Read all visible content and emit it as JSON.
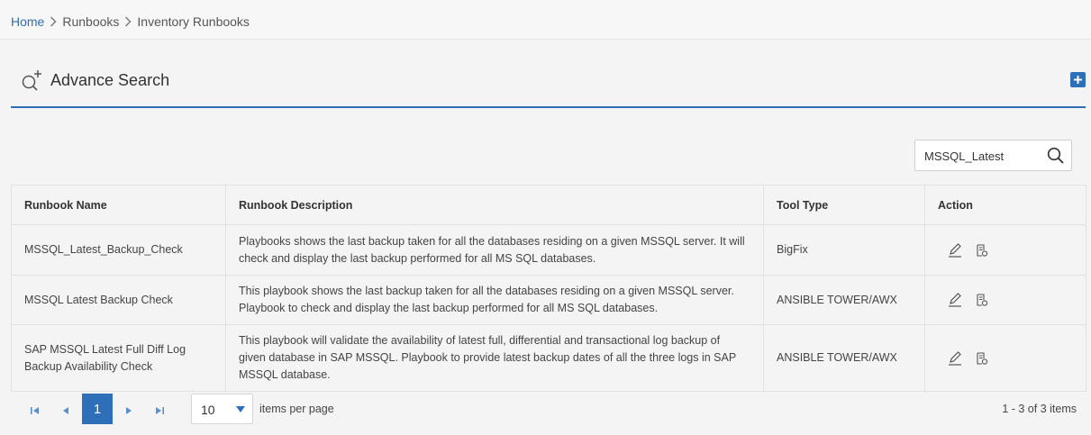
{
  "breadcrumb": {
    "home": "Home",
    "runbooks": "Runbooks",
    "current": "Inventory Runbooks"
  },
  "advance_search": {
    "title": "Advance Search"
  },
  "search": {
    "value": "MSSQL_Latest"
  },
  "table": {
    "headers": [
      "Runbook Name",
      "Runbook Description",
      "Tool Type",
      "Action"
    ],
    "rows": [
      {
        "name": "MSSQL_Latest_Backup_Check",
        "description": "Playbooks shows the last backup taken for all the databases residing on a given MSSQL server. It will check and display the last backup performed for all MS SQL databases.",
        "tool": "BigFix"
      },
      {
        "name": "MSSQL Latest Backup Check",
        "description": "This playbook shows the last backup taken for all the databases residing on a given MSSQL server. Playbook to check and display the last backup performed for all MS SQL databases.",
        "tool": "ANSIBLE TOWER/AWX"
      },
      {
        "name": "SAP MSSQL Latest Full Diff Log Backup Availability Check",
        "description": "This playbook will validate the availability of latest full, differential and transactional log backup of given database in SAP MSSQL. Playbook to provide latest backup dates of all the three logs in SAP MSSQL database.",
        "tool": "ANSIBLE TOWER/AWX"
      }
    ]
  },
  "pager": {
    "current_page": "1",
    "page_size": "10",
    "items_per_page_label": "items per page",
    "info": "1 - 3 of 3 items"
  },
  "icons": {
    "advance_search": "search-plus-icon",
    "add": "plus-icon",
    "search": "search-icon",
    "edit": "pencil-icon",
    "details": "document-icon"
  },
  "colors": {
    "accent": "#2d6fb8",
    "background": "#f4f4f4"
  }
}
